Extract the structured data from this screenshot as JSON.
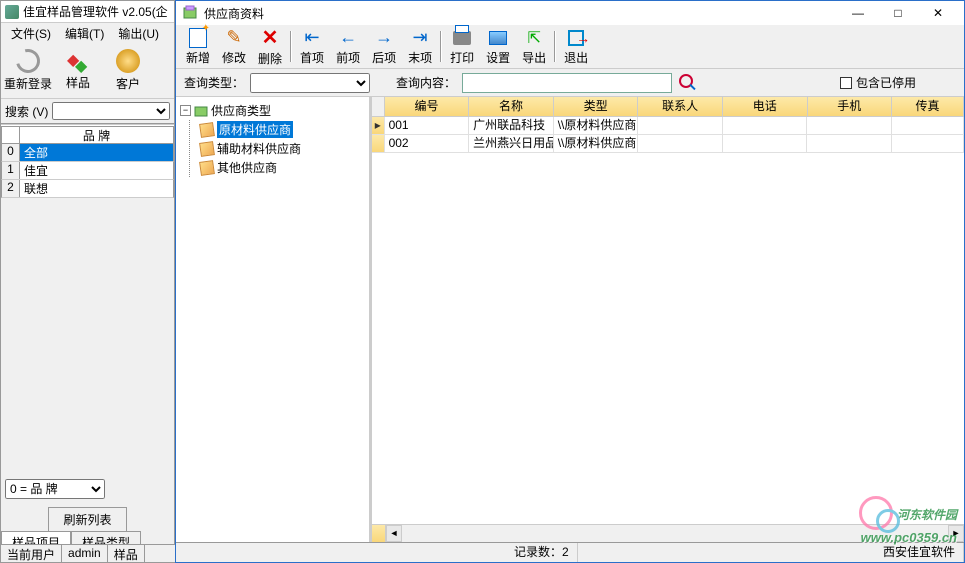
{
  "back": {
    "title": "佳宜样品管理软件 v2.05(企",
    "menu": {
      "file": "文件(S)",
      "edit": "编辑(T)",
      "output": "输出(U)"
    },
    "toolbar": {
      "relogin": "重新登录",
      "sample": "样品",
      "customer": "客户"
    },
    "search_label": "搜索 (V)",
    "brand_header": "品    牌",
    "brands": [
      {
        "idx": "0",
        "name": "全部"
      },
      {
        "idx": "1",
        "name": "佳宜"
      },
      {
        "idx": "2",
        "name": "联想"
      }
    ],
    "filter": "0 = 品    牌",
    "refresh": "刷新列表",
    "tabs": {
      "items": "样品项目",
      "types": "样品类型"
    },
    "status": {
      "label": "当前用户",
      "user": "admin",
      "extra": "样品"
    }
  },
  "front": {
    "title": "供应商资料",
    "toolbar": {
      "new": "新增",
      "edit": "修改",
      "delete": "删除",
      "first": "首项",
      "prev": "前项",
      "next": "后项",
      "last": "末项",
      "print": "打印",
      "settings": "设置",
      "export": "导出",
      "exit": "退出"
    },
    "query": {
      "type_label": "查询类型：",
      "content_label": "查询内容：",
      "include_disabled": "包含已停用"
    },
    "tree": {
      "root": "供应商类型",
      "children": [
        "原材料供应商",
        "辅助材料供应商",
        "其他供应商"
      ]
    },
    "grid": {
      "headers": {
        "id": "编号",
        "name": "名称",
        "type": "类型",
        "contact": "联系人",
        "phone": "电话",
        "mobile": "手机",
        "fax": "传真"
      },
      "rows": [
        {
          "id": "001",
          "name": "广州联品科技",
          "type": "\\\\原材料供应商",
          "contact": "",
          "phone": "",
          "mobile": "",
          "fax": ""
        },
        {
          "id": "002",
          "name": "兰州燕兴日用品",
          "type": "\\\\原材料供应商",
          "contact": "",
          "phone": "",
          "mobile": "",
          "fax": ""
        }
      ]
    },
    "status": {
      "records_label": "记录数：",
      "records": "2",
      "right": "西安佳宜软件"
    }
  },
  "watermark": {
    "name": "河东软件园",
    "url": "www.pc0359.cn"
  }
}
